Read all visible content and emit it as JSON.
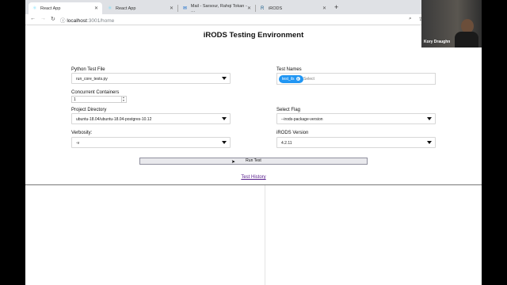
{
  "browser": {
    "tabs": [
      {
        "label": "React App",
        "icon": "react-icon"
      },
      {
        "label": "React App",
        "icon": "react-icon"
      },
      {
        "label": "Mail - Sarsour, Rahqi Tokan - …",
        "icon": "mail-icon"
      },
      {
        "label": "iRODS",
        "icon": "irods-icon"
      }
    ],
    "new_tab": "+",
    "url_host": "localhost",
    "url_rest": ":3001/home"
  },
  "page": {
    "title": "iRODS Testing Environment",
    "python_test_file": {
      "label": "Python Test File",
      "value": "run_core_tests.py"
    },
    "test_names": {
      "label": "Test Names",
      "chip": "test_ils",
      "placeholder": "Select"
    },
    "concurrent_containers": {
      "label": "Concurrent Containers",
      "value": "1"
    },
    "project_directory": {
      "label": "Project Directory",
      "value": "ubuntu-18.04/ubuntu-18.04-postgres-10.12"
    },
    "select_flag": {
      "label": "Select Flag",
      "value": "--irods-package-version"
    },
    "verbosity": {
      "label": "Verbosity:",
      "value": "-v"
    },
    "irods_version": {
      "label": "iRODS Version",
      "value": "4.2.11"
    },
    "run_button": "Run Test",
    "history_link": "Test History"
  },
  "video": {
    "name": "Kory Draughn"
  }
}
